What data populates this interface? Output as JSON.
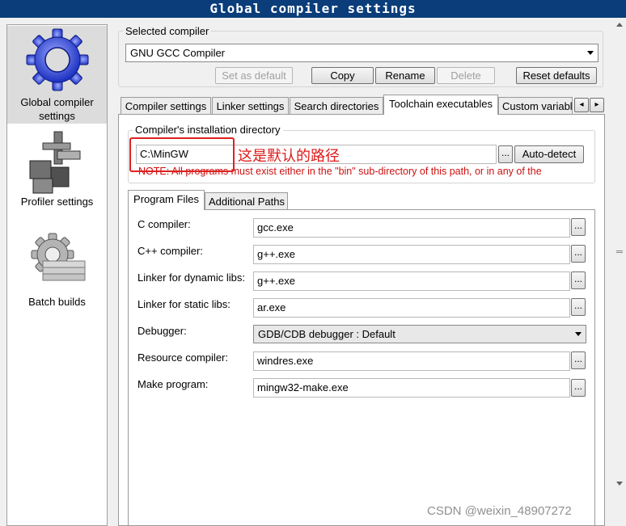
{
  "window": {
    "title": "Global compiler settings"
  },
  "categories": [
    {
      "label": "Global compiler settings",
      "icon": "gear-icon",
      "selected": true
    },
    {
      "label": "Profiler settings",
      "icon": "profiler-icon",
      "selected": false
    },
    {
      "label": "Batch builds",
      "icon": "batch-gear-icon",
      "selected": false
    }
  ],
  "selected_compiler": {
    "group_label": "Selected compiler",
    "value": "GNU GCC Compiler",
    "buttons": {
      "set_default": "Set as default",
      "copy": "Copy",
      "rename": "Rename",
      "delete": "Delete",
      "reset": "Reset defaults"
    }
  },
  "tabs": [
    "Compiler settings",
    "Linker settings",
    "Search directories",
    "Toolchain executables",
    "Custom variabl"
  ],
  "active_tab": "Toolchain executables",
  "install_dir": {
    "group_label": "Compiler's installation directory",
    "value": "C:\\MinGW",
    "browse": "...",
    "autodetect": "Auto-detect",
    "note": "NOTE: All programs must exist either in the \"bin\" sub-directory of this path, or in any of the"
  },
  "annotation": "这是默认的路径",
  "subtabs": [
    "Program Files",
    "Additional Paths"
  ],
  "programs": [
    {
      "label": "C compiler:",
      "value": "gcc.exe",
      "type": "text"
    },
    {
      "label": "C++ compiler:",
      "value": "g++.exe",
      "type": "text"
    },
    {
      "label": "Linker for dynamic libs:",
      "value": "g++.exe",
      "type": "text"
    },
    {
      "label": "Linker for static libs:",
      "value": "ar.exe",
      "type": "text"
    },
    {
      "label": "Debugger:",
      "value": "GDB/CDB debugger : Default",
      "type": "select"
    },
    {
      "label": "Resource compiler:",
      "value": "windres.exe",
      "type": "text"
    },
    {
      "label": "Make program:",
      "value": "mingw32-make.exe",
      "type": "text"
    }
  ],
  "browse_label": "...",
  "watermark": "CSDN @weixin_48907272"
}
